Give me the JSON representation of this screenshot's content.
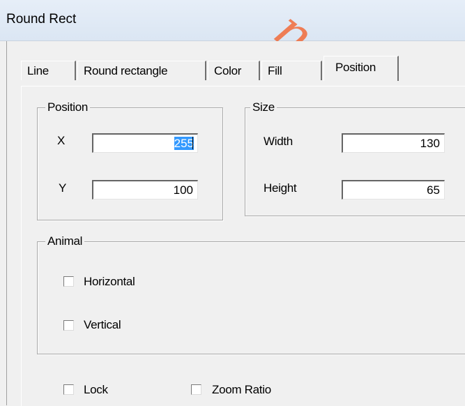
{
  "window": {
    "title": "Round Rect"
  },
  "watermark": "nghoa",
  "tabs": [
    {
      "label": "Line"
    },
    {
      "label": "Round rectangle"
    },
    {
      "label": "Color"
    },
    {
      "label": "Fill"
    },
    {
      "label": "Position",
      "active": true
    }
  ],
  "position_group": {
    "legend": "Position",
    "x_label": "X",
    "x_value": "255",
    "y_label": "Y",
    "y_value": "100"
  },
  "size_group": {
    "legend": "Size",
    "width_label": "Width",
    "width_value": "130",
    "height_label": "Height",
    "height_value": "65"
  },
  "animal_group": {
    "legend": "Animal",
    "horizontal_label": "Horizontal",
    "horizontal_checked": false,
    "vertical_label": "Vertical",
    "vertical_checked": false
  },
  "options": {
    "lock_label": "Lock",
    "lock_checked": false,
    "zoom_label": "Zoom Ratio",
    "zoom_checked": false
  }
}
